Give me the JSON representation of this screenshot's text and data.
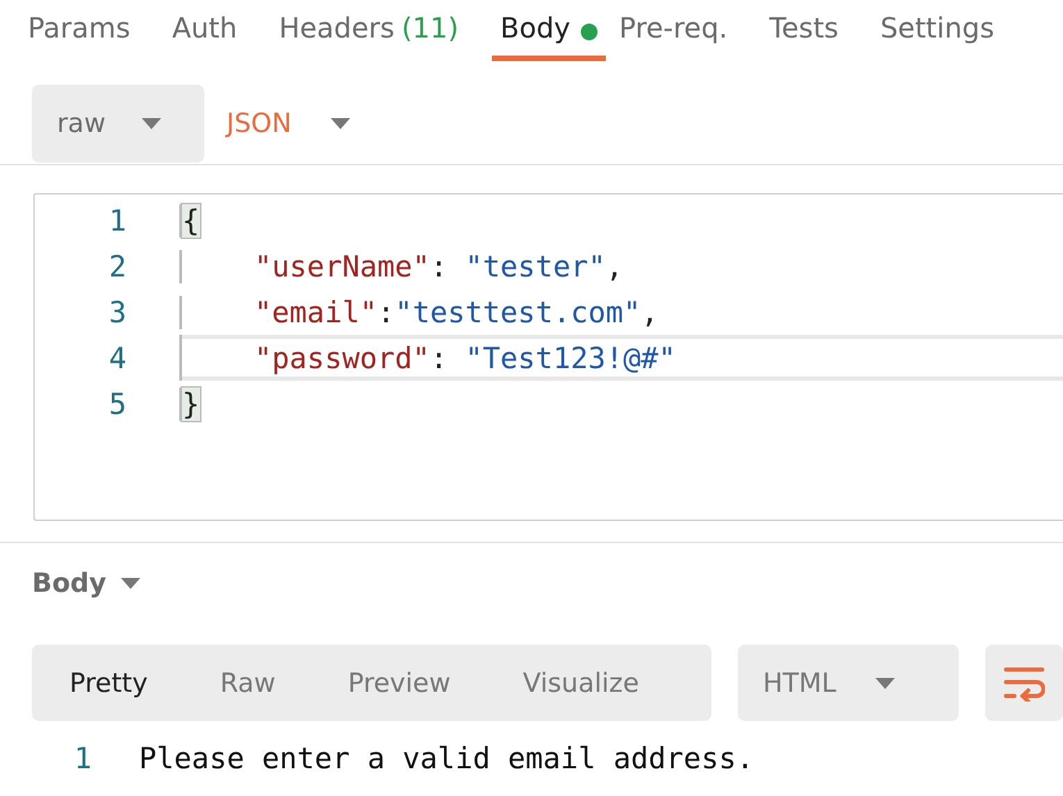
{
  "tabs": [
    {
      "label": "Params",
      "selected": false,
      "indicator": false
    },
    {
      "label": "Auth",
      "selected": false,
      "indicator": false
    },
    {
      "label": "Headers",
      "count": "(11)",
      "selected": false,
      "indicator": false
    },
    {
      "label": "Body",
      "selected": true,
      "indicator": true
    },
    {
      "label": "Pre-req.",
      "selected": false,
      "indicator": false
    },
    {
      "label": "Tests",
      "selected": false,
      "indicator": false
    },
    {
      "label": "Settings",
      "selected": false,
      "indicator": false
    }
  ],
  "body_type": {
    "mode": "raw",
    "language": "JSON"
  },
  "editor": {
    "lines": [
      {
        "number": "1",
        "active": false,
        "tokens": [
          {
            "kind": "bracket",
            "text": "{"
          }
        ]
      },
      {
        "number": "2",
        "active": false,
        "indent": true,
        "tokens": [
          {
            "kind": "key",
            "text": "\"userName\""
          },
          {
            "kind": "punct",
            "text": ": "
          },
          {
            "kind": "string",
            "text": "\"tester\""
          },
          {
            "kind": "punct",
            "text": ","
          }
        ]
      },
      {
        "number": "3",
        "active": false,
        "indent": true,
        "tokens": [
          {
            "kind": "key",
            "text": "\"email\""
          },
          {
            "kind": "punct",
            "text": ":"
          },
          {
            "kind": "string",
            "text": "\"testtest.com\""
          },
          {
            "kind": "punct",
            "text": ","
          }
        ]
      },
      {
        "number": "4",
        "active": true,
        "indent": true,
        "tokens": [
          {
            "kind": "key",
            "text": "\"password\""
          },
          {
            "kind": "punct",
            "text": ": "
          },
          {
            "kind": "string",
            "text": "\"Test123!@#\""
          }
        ]
      },
      {
        "number": "5",
        "active": false,
        "tokens": [
          {
            "kind": "bracket",
            "text": "}"
          }
        ]
      }
    ]
  },
  "response": {
    "title": "Body",
    "views": [
      {
        "label": "Pretty",
        "selected": true
      },
      {
        "label": "Raw",
        "selected": false
      },
      {
        "label": "Preview",
        "selected": false
      },
      {
        "label": "Visualize",
        "selected": false
      }
    ],
    "format": "HTML",
    "lines": [
      {
        "number": "1",
        "text": "Please enter a valid email address."
      }
    ]
  }
}
